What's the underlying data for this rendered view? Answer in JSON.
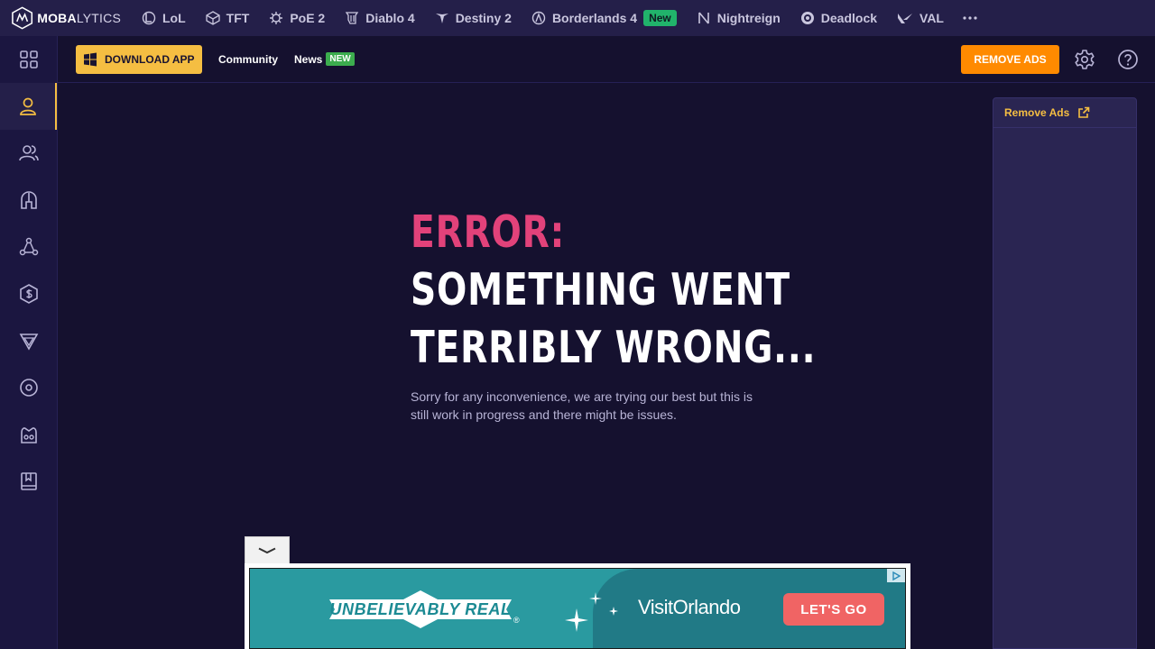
{
  "brand": {
    "name_bold": "MOBA",
    "name_light": "LYTICS"
  },
  "games": [
    {
      "label": "LoL",
      "icon": "lol-icon"
    },
    {
      "label": "TFT",
      "icon": "tft-icon"
    },
    {
      "label": "PoE 2",
      "icon": "poe2-icon"
    },
    {
      "label": "Diablo 4",
      "icon": "diablo4-icon"
    },
    {
      "label": "Destiny 2",
      "icon": "destiny2-icon"
    },
    {
      "label": "Borderlands 4",
      "icon": "borderlands4-icon",
      "badge": "New"
    },
    {
      "label": "Nightreign",
      "icon": "nightreign-icon"
    },
    {
      "label": "Deadlock",
      "icon": "deadlock-icon"
    },
    {
      "label": "VAL",
      "icon": "valorant-icon"
    }
  ],
  "subheader": {
    "download_label": "DOWNLOAD APP",
    "community_label": "Community",
    "news_label": "News",
    "news_badge": "NEW",
    "remove_ads_label": "REMOVE ADS"
  },
  "error": {
    "label": "ERROR:",
    "line1": "SOMETHING WENT",
    "line2": "TERRIBLY WRONG...",
    "message": "Sorry for any inconvenience, we are trying our best but this is still work in progress and there might be issues."
  },
  "ad_panel": {
    "link_label": "Remove Ads"
  },
  "banner": {
    "tagline": "UNBELIEVABLY REAL",
    "brand_visit": "Visit",
    "brand_city": "Orlando",
    "cta": "LET'S GO"
  },
  "colors": {
    "accent": "#f5be42",
    "error": "#e2427a",
    "remove_ads": "#ff8a00",
    "background": "#15112f",
    "topbar": "#241f49"
  }
}
